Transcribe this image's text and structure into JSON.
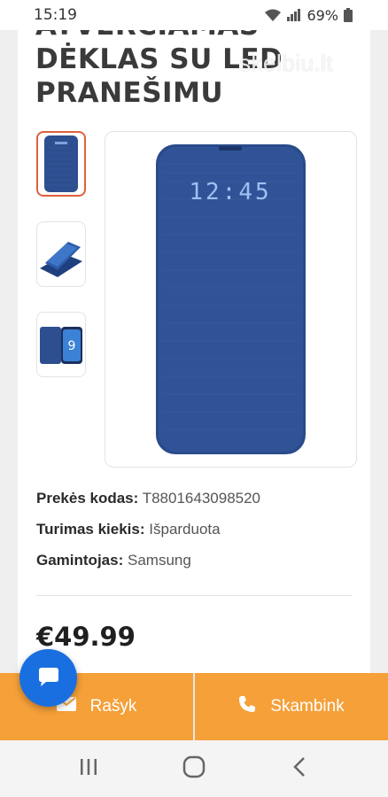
{
  "status_bar": {
    "time": "15:19",
    "battery": "69%"
  },
  "product": {
    "title_line1": "ATVERČIAMAS",
    "title_line2": "DĖKLAS SU LED",
    "title_line3": "PRANEŠIMU",
    "watermark": "skelbiu.lt",
    "led_clock": "12:45",
    "specs": [
      {
        "label": "Prekės kodas:",
        "value": "T8801643098520"
      },
      {
        "label": "Turimas kiekis:",
        "value": "Išparduota"
      },
      {
        "label": "Gamintojas:",
        "value": "Samsung"
      }
    ],
    "price": "€49.99"
  },
  "actions": {
    "write_label": "Rašyk",
    "call_label": "Skambink"
  },
  "colors": {
    "accent_orange": "#f5a039",
    "fab_blue": "#1a6fe0",
    "case_blue": "#2d4f8f",
    "active_thumb_border": "#e0603c"
  },
  "icons": {
    "chat": "chat-bubble-icon",
    "mail": "mail-icon",
    "phone": "phone-icon",
    "wifi": "wifi-icon",
    "signal": "signal-icon",
    "battery": "battery-icon",
    "recents": "recents-icon",
    "home": "home-icon",
    "back": "back-icon"
  }
}
